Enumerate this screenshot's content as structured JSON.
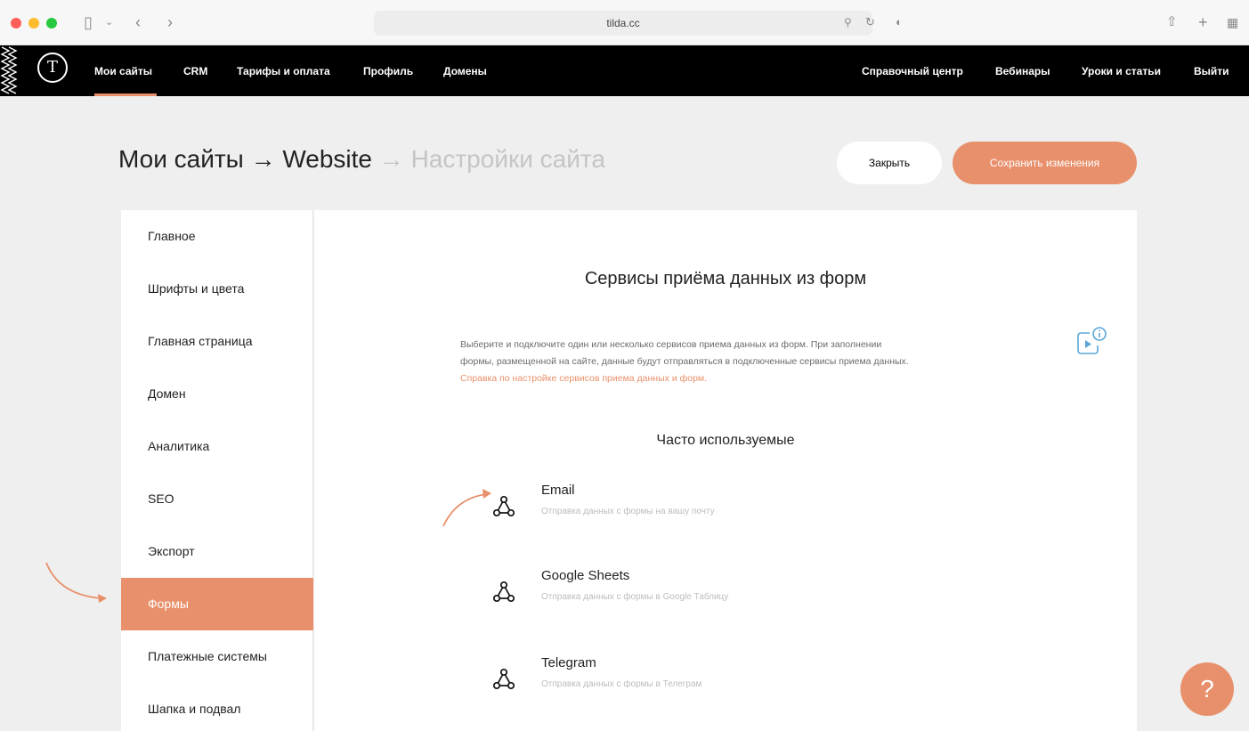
{
  "browser": {
    "url": "tilda.cc",
    "traffic_colors": [
      "#ff5f57",
      "#febc2e",
      "#28c840"
    ]
  },
  "nav": {
    "logo": "T",
    "left_items": [
      "Мои сайты",
      "CRM",
      "Тарифы и оплата",
      "Профиль",
      "Домены"
    ],
    "right_items": [
      "Справочный центр",
      "Вебинары",
      "Уроки и статьи",
      "Выйти"
    ]
  },
  "header": {
    "crumb_1": "Мои сайты",
    "crumb_2": "Website",
    "crumb_3": "Настройки сайта",
    "arrow": "→",
    "close_label": "Закрыть",
    "save_label": "Сохранить изменения"
  },
  "sidebar": {
    "items": [
      {
        "label": "Главное"
      },
      {
        "label": "Шрифты и цвета"
      },
      {
        "label": "Главная страница"
      },
      {
        "label": "Домен"
      },
      {
        "label": "Аналитика"
      },
      {
        "label": "SEO"
      },
      {
        "label": "Экспорт"
      },
      {
        "label": "Формы",
        "active": true
      },
      {
        "label": "Платежные системы"
      },
      {
        "label": "Шапка и подвал"
      }
    ]
  },
  "main": {
    "title": "Сервисы приёма данных из форм",
    "description_line1": "Выберите и подключите один или несколько сервисов приема данных из форм. При заполнении",
    "description_line2": "формы, размещенной на сайте, данные будут отправляться в подключенные сервисы приема данных.",
    "help_link": "Справка по настройке сервисов приема данных и форм.",
    "section_title": "Часто используемые",
    "services": [
      {
        "name": "Email",
        "description": "Отправка данных с формы на вашу почту"
      },
      {
        "name": "Google Sheets",
        "description": "Отправка данных с формы в Google Таблицу"
      },
      {
        "name": "Telegram",
        "description": "Отправка данных с формы в Телеграм"
      }
    ]
  },
  "help_button": "?",
  "colors": {
    "accent": "#e8906b",
    "nav_bg": "#000000",
    "page_bg": "#efefef"
  }
}
